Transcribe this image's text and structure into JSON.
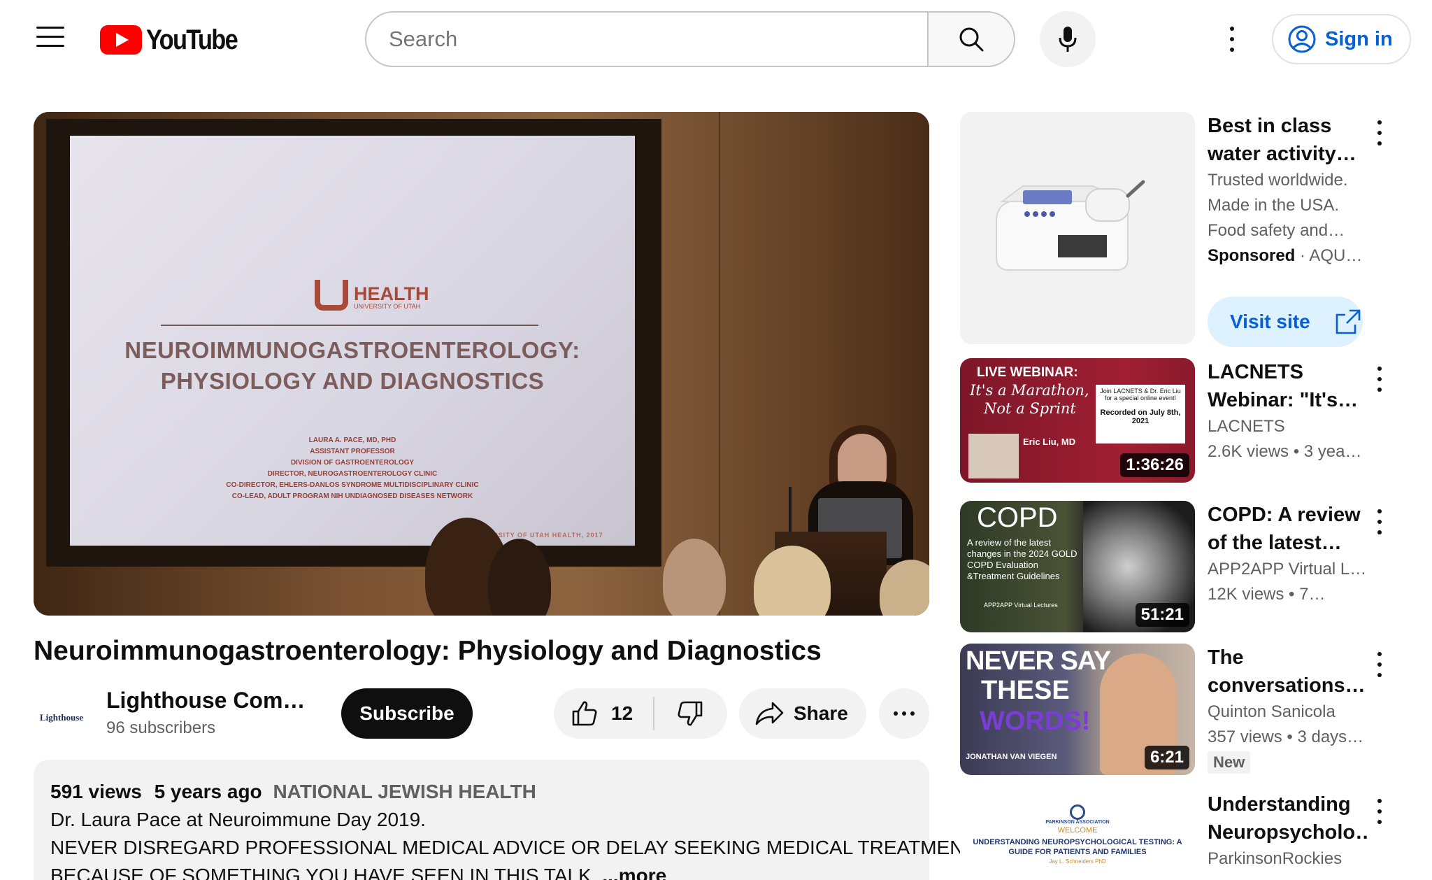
{
  "header": {
    "logo_text": "YouTube",
    "search_placeholder": "Search",
    "signin_label": "Sign in"
  },
  "player": {
    "slide_logo": "HEALTH",
    "slide_logo_sub": "UNIVERSITY OF UTAH",
    "slide_title_1": "NEUROIMMUNOGASTROENTEROLOGY:",
    "slide_title_2": "PHYSIOLOGY AND DIAGNOSTICS",
    "slide_credits": [
      "LAURA A. PACE, MD, PHD",
      "ASSISTANT PROFESSOR",
      "DIVISION OF GASTROENTEROLOGY",
      "DIRECTOR, NEUROGASTROENTEROLOGY CLINIC",
      "CO-DIRECTOR, EHLERS-DANLOS SYNDROME MULTIDISCIPLINARY CLINIC",
      "CO-LEAD, ADULT PROGRAM NIH UNDIAGNOSED DISEASES NETWORK"
    ],
    "slide_footer": "©UNIVERSITY OF UTAH HEALTH, 2017"
  },
  "video": {
    "title": "Neuroimmunogastroenterology: Physiology and Diagnostics",
    "channel_name": "Lighthouse Complex Care",
    "channel_avatar_text": "Lighthouse",
    "subscribers": "96 subscribers",
    "subscribe_label": "Subscribe",
    "like_count": "12",
    "share_label": "Share"
  },
  "description": {
    "views": "591 views",
    "age": "5 years ago",
    "tag": "NATIONAL JEWISH HEALTH",
    "line1": "Dr. Laura Pace at Neuroimmune Day 2019.",
    "line2": "NEVER DISREGARD PROFESSIONAL MEDICAL ADVICE OR DELAY SEEKING MEDICAL TREATMENT",
    "line3": "BECAUSE OF SOMETHING YOU HAVE SEEN IN THIS TALK",
    "line3_fade": ".",
    "more": "...more"
  },
  "sidebar": {
    "ad": {
      "title": "Best in class water activity…",
      "desc": "Trusted worldwide. Made in the USA. Food safety and…",
      "sponsored": "Sponsored",
      "advertiser": "AQUA…",
      "visit_label": "Visit site"
    },
    "items": [
      {
        "title": "LACNETS Webinar: \"It's a…",
        "channel": "LACNETS",
        "meta": "2.6K views  • 3 yea…",
        "duration": "1:36:26",
        "thumb": {
          "line1": "LIVE WEBINAR:",
          "line2": "It's a Marathon,",
          "line3": "Not a Sprint",
          "speaker": "Eric Liu, MD",
          "box1": "Join LACNETS & Dr. Eric Liu for a special online event!",
          "box2": "Recorded on July 8th, 2021"
        }
      },
      {
        "title": "COPD: A review of the latest…",
        "channel": "APP2APP Virtual L…",
        "meta": "12K views  • 7…",
        "duration": "51:21",
        "thumb": {
          "big": "COPD",
          "small": "A review of the latest changes in the 2024 GOLD COPD Evaluation &Treatment Guidelines",
          "brand": "APP2APP Virtual Lectures"
        }
      },
      {
        "title": "The conversations…",
        "channel": "Quinton Sanicola",
        "meta": "357 views  • 3 days…",
        "duration": "6:21",
        "badge": "New",
        "thumb": {
          "line1": "NEVER SAY",
          "line2": "THESE",
          "line3": "WORDS!",
          "name": "JONATHAN VAN VIEGEN"
        }
      },
      {
        "title": "Understanding Neuropsycholo…",
        "channel": "ParkinsonRockies",
        "thumb": {
          "org": "PARKINSON ASSOCIATION",
          "welcome": "WELCOME",
          "headline": "UNDERSTANDING NEUROPSYCHOLOGICAL TESTING: A GUIDE FOR PATIENTS AND FAMILIES",
          "presenter": "Jay L. Schneiders PhD"
        }
      }
    ]
  },
  "colors": {
    "brand_red": "#ff0000",
    "link_blue": "#065fd4",
    "chip_bg": "#f2f2f2"
  }
}
